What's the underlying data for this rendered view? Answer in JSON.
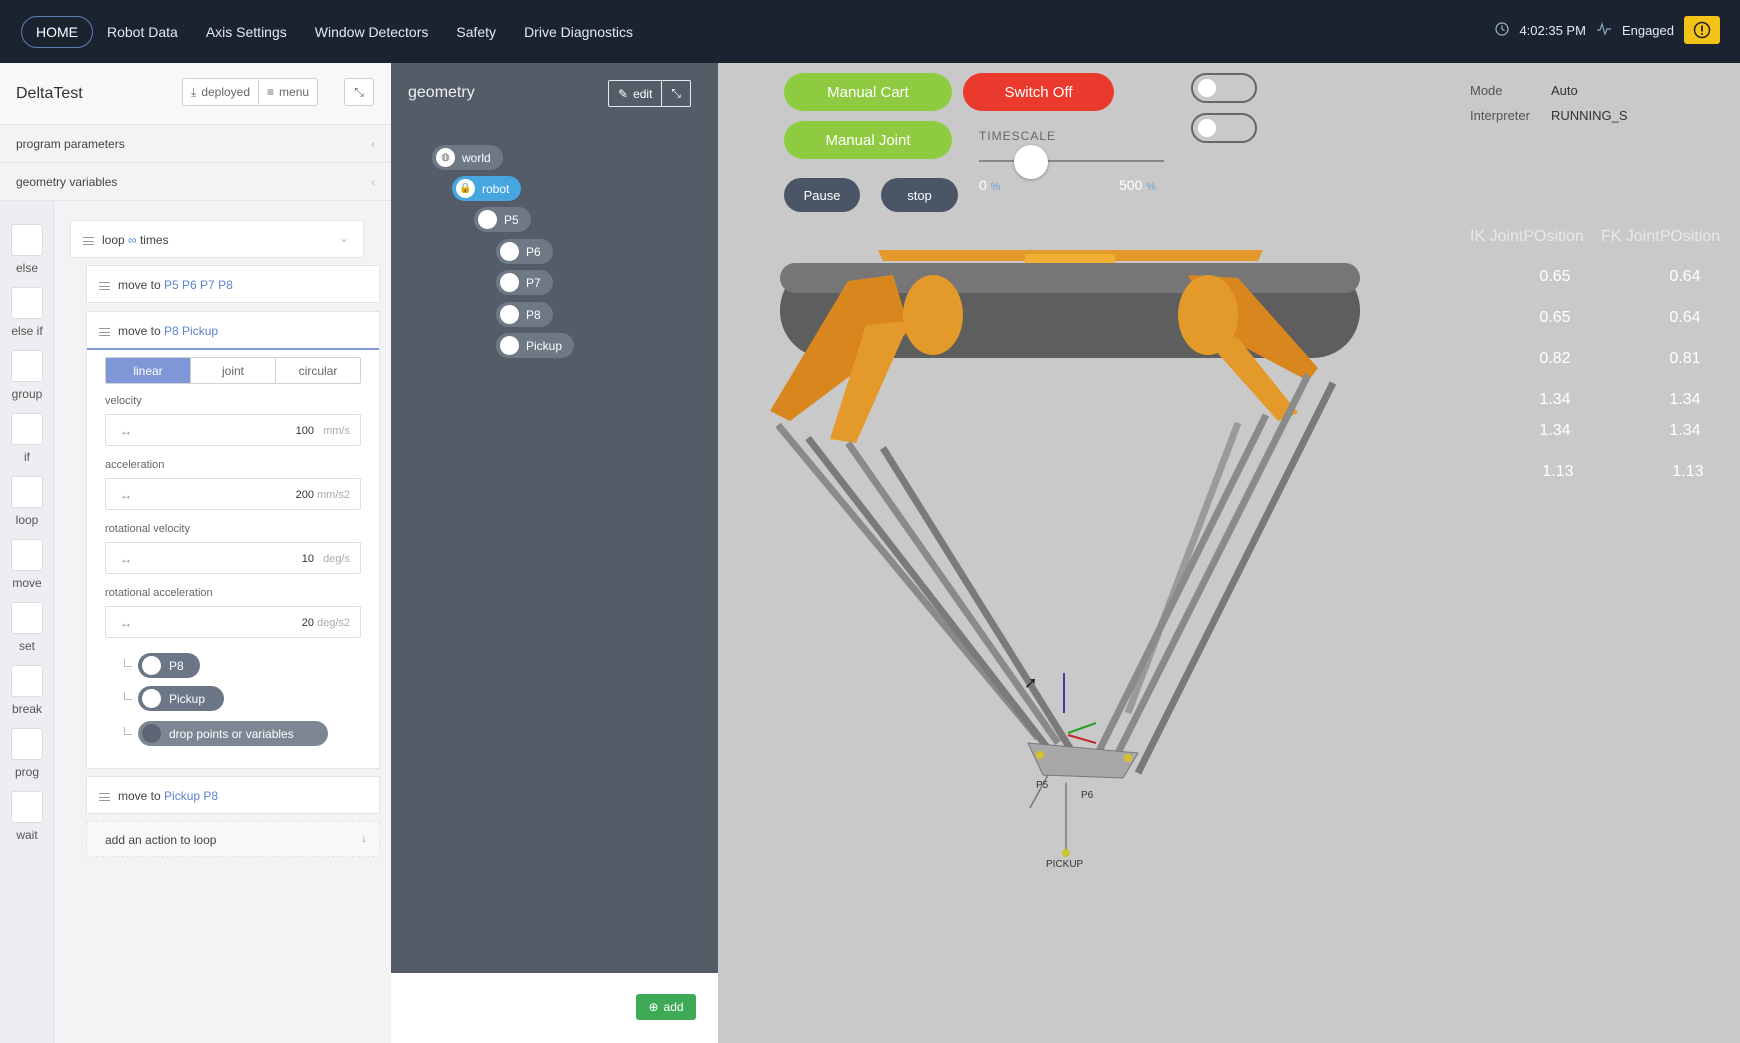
{
  "nav": {
    "items": [
      "HOME",
      "Robot Data",
      "Axis Settings",
      "Window Detectors",
      "Safety",
      "Drive Diagnostics"
    ],
    "time": "4:02:35 PM",
    "status": "Engaged"
  },
  "program": {
    "title": "DeltaTest",
    "deployed_label": "deployed",
    "menu_label": "menu",
    "sections": [
      "program parameters",
      "geometry variables"
    ]
  },
  "tools": [
    "else",
    "else if",
    "group",
    "if",
    "loop",
    "move",
    "set",
    "break",
    "prog",
    "wait"
  ],
  "loop": {
    "label_loop": "loop",
    "infinity": "∞",
    "label_times": "times"
  },
  "move1": {
    "prefix": "move to",
    "targets": "P5 P6 P7 P8"
  },
  "move2": {
    "prefix": "move to",
    "targets": "P8 Pickup",
    "modes": [
      "linear",
      "joint",
      "circular"
    ],
    "active_mode": "linear",
    "params": [
      {
        "label": "velocity",
        "value": "100",
        "unit": "mm/s"
      },
      {
        "label": "acceleration",
        "value": "200",
        "unit": "mm/s2"
      },
      {
        "label": "rotational velocity",
        "value": "10",
        "unit": "deg/s"
      },
      {
        "label": "rotational acceleration",
        "value": "20",
        "unit": "deg/s2"
      }
    ],
    "points": [
      "P8",
      "Pickup",
      "drop points or variables"
    ]
  },
  "move3": {
    "prefix": "move to",
    "targets": "Pickup P8"
  },
  "add_action": "add an action to loop",
  "geometry": {
    "title": "geometry",
    "edit_label": "edit",
    "tree": [
      "world",
      "robot",
      "P5",
      "P6",
      "P7",
      "P8",
      "Pickup"
    ],
    "add_label": "add"
  },
  "controls": {
    "manual_cart": "Manual Cart",
    "switch_off": "Switch Off",
    "manual_joint": "Manual Joint",
    "pause": "Pause",
    "stop": "stop",
    "timescale_label": "TIMESCALE",
    "timescale_min": "0",
    "timescale_max": "500",
    "timescale_unit": "%",
    "timescale_level": 0.1
  },
  "status": {
    "mode_label": "Mode",
    "mode_value": "Auto",
    "interp_label": "Interpreter",
    "interp_value": "RUNNING_S"
  },
  "joints": {
    "headers": [
      "IK JointPOsition",
      "FK JointPOsition"
    ],
    "ik": [
      "0.65",
      "0.65",
      "0.82",
      "1.34",
      "1.34",
      "1.13"
    ],
    "fk": [
      "0.64",
      "0.64",
      "0.81",
      "1.34",
      "1.34",
      "1.13"
    ]
  },
  "scene": {
    "labels": [
      "P5",
      "P6",
      "PICKUP"
    ]
  },
  "colors": {
    "topbar": "#1b2330",
    "accent_green": "#8fcb40",
    "accent_red": "#ea3a2d",
    "robot_orange": "#e39a2a"
  }
}
